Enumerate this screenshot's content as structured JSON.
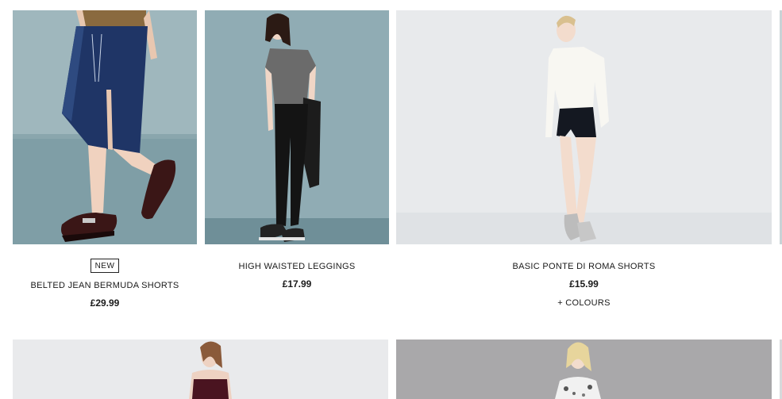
{
  "products": [
    {
      "badge": "NEW",
      "name": "BELTED JEAN BERMUDA SHORTS",
      "price": "£29.99",
      "image_icon": "product-photo"
    },
    {
      "name": "HIGH WAISTED LEGGINGS",
      "price": "£17.99",
      "image_icon": "product-photo"
    },
    {
      "name": "BASIC PONTE DI ROMA SHORTS",
      "price": "£15.99",
      "colours_link": "+ COLOURS",
      "image_icon": "product-photo"
    }
  ],
  "colors": {
    "text": "#1a1a1a",
    "teal_background": "#8fa9b1",
    "light_background": "#e9ebed"
  }
}
